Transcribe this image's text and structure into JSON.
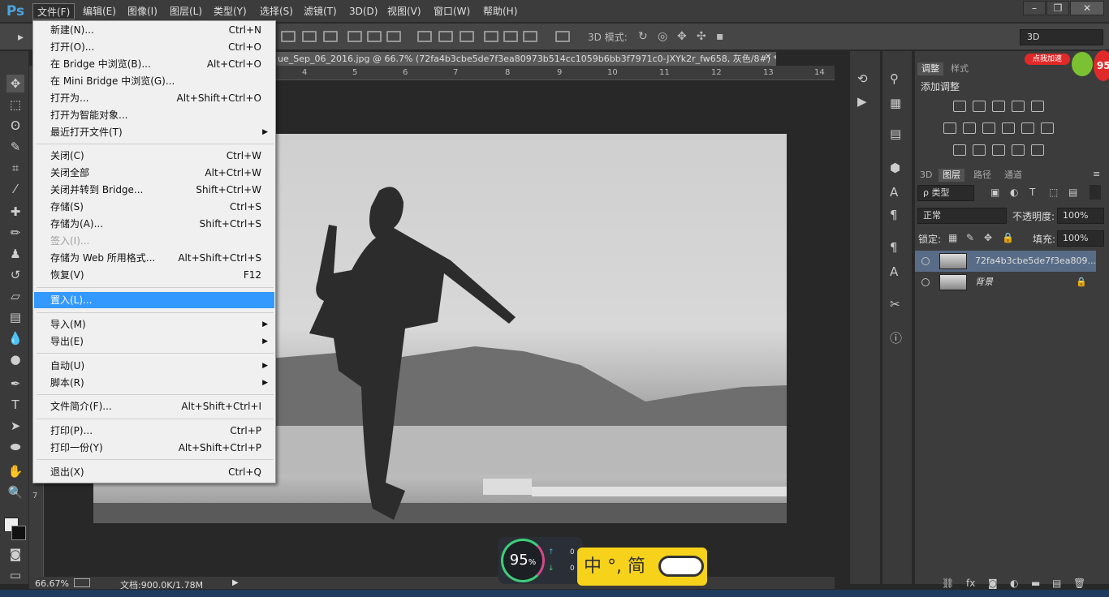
{
  "app": {
    "logo": "Ps"
  },
  "menubar": {
    "items": [
      "文件(F)",
      "编辑(E)",
      "图像(I)",
      "图层(L)",
      "类型(Y)",
      "选择(S)",
      "滤镜(T)",
      "3D(D)",
      "视图(V)",
      "窗口(W)",
      "帮助(H)"
    ],
    "window_buttons": {
      "minimize": "–",
      "restore": "❐",
      "close": "✕"
    }
  },
  "options_bar": {
    "mode3d_label": "3D 模式:",
    "workspace_select": "3D"
  },
  "document": {
    "tab_title": "ue_Sep_06_2016.jpg @ 66.7% (72fa4b3cbe5de7f3ea80973b514cc1059b6bb3f7971c0-JXYk2r_fw658, 灰色/8#) *",
    "tab_close": "✕",
    "ruler_ticks": [
      "4",
      "5",
      "6",
      "7",
      "8",
      "9",
      "10",
      "11",
      "12",
      "13",
      "14"
    ],
    "vruler_ticks": [
      "7"
    ]
  },
  "file_menu": {
    "items": [
      {
        "label": "新建(N)...",
        "shortcut": "Ctrl+N"
      },
      {
        "label": "打开(O)...",
        "shortcut": "Ctrl+O"
      },
      {
        "label": "在 Bridge 中浏览(B)...",
        "shortcut": "Alt+Ctrl+O"
      },
      {
        "label": "在 Mini Bridge 中浏览(G)...",
        "shortcut": ""
      },
      {
        "label": "打开为...",
        "shortcut": "Alt+Shift+Ctrl+O"
      },
      {
        "label": "打开为智能对象...",
        "shortcut": ""
      },
      {
        "label": "最近打开文件(T)",
        "shortcut": "",
        "submenu": true
      },
      {
        "label": "关闭(C)",
        "shortcut": "Ctrl+W"
      },
      {
        "label": "关闭全部",
        "shortcut": "Alt+Ctrl+W"
      },
      {
        "label": "关闭并转到 Bridge...",
        "shortcut": "Shift+Ctrl+W"
      },
      {
        "label": "存储(S)",
        "shortcut": "Ctrl+S"
      },
      {
        "label": "存储为(A)...",
        "shortcut": "Shift+Ctrl+S"
      },
      {
        "label": "签入(I)...",
        "shortcut": "",
        "disabled": true
      },
      {
        "label": "存储为 Web 所用格式...",
        "shortcut": "Alt+Shift+Ctrl+S"
      },
      {
        "label": "恢复(V)",
        "shortcut": "F12"
      },
      {
        "label": "置入(L)...",
        "shortcut": "",
        "highlighted": true
      },
      {
        "label": "导入(M)",
        "shortcut": "",
        "submenu": true
      },
      {
        "label": "导出(E)",
        "shortcut": "",
        "submenu": true
      },
      {
        "label": "自动(U)",
        "shortcut": "",
        "submenu": true
      },
      {
        "label": "脚本(R)",
        "shortcut": "",
        "submenu": true
      },
      {
        "label": "文件简介(F)...",
        "shortcut": "Alt+Shift+Ctrl+I"
      },
      {
        "label": "打印(P)...",
        "shortcut": "Ctrl+P"
      },
      {
        "label": "打印一份(Y)",
        "shortcut": "Alt+Shift+Ctrl+P"
      },
      {
        "label": "退出(X)",
        "shortcut": "Ctrl+Q"
      }
    ],
    "submenu_arrow": "▶"
  },
  "adjust_panel": {
    "tabs": [
      "调整",
      "样式"
    ],
    "title": "添加调整"
  },
  "layers_panel": {
    "tabs": [
      "3D",
      "图层",
      "路径",
      "通道"
    ],
    "filter_label": "ρ 类型",
    "blend_mode": "正常",
    "opacity_label": "不透明度:",
    "opacity_value": "100%",
    "lock_label": "锁定:",
    "fill_label": "填充:",
    "fill_value": "100%",
    "layers": [
      {
        "name": "72fa4b3cbe5de7f3ea809...",
        "selected": true
      },
      {
        "name": "背景",
        "locked": true
      }
    ],
    "footer_icons": [
      "⛓",
      "fx",
      "◙",
      "◐",
      "▬",
      "▤",
      "🗑"
    ]
  },
  "status": {
    "zoom": "66.67%",
    "doc": "文档:900.0K/1.78M"
  },
  "overlays": {
    "speed_percent": "95",
    "speed_unit": "%",
    "speed_up": "0",
    "speed_down": "0",
    "ime_text": "中 °, 简",
    "promo_badge": "点我加速",
    "promo_number": "95"
  },
  "colors": {
    "menu_highlight": "#3399ff",
    "layer_selected": "#586c87",
    "ps_blue": "#4aa3df"
  }
}
